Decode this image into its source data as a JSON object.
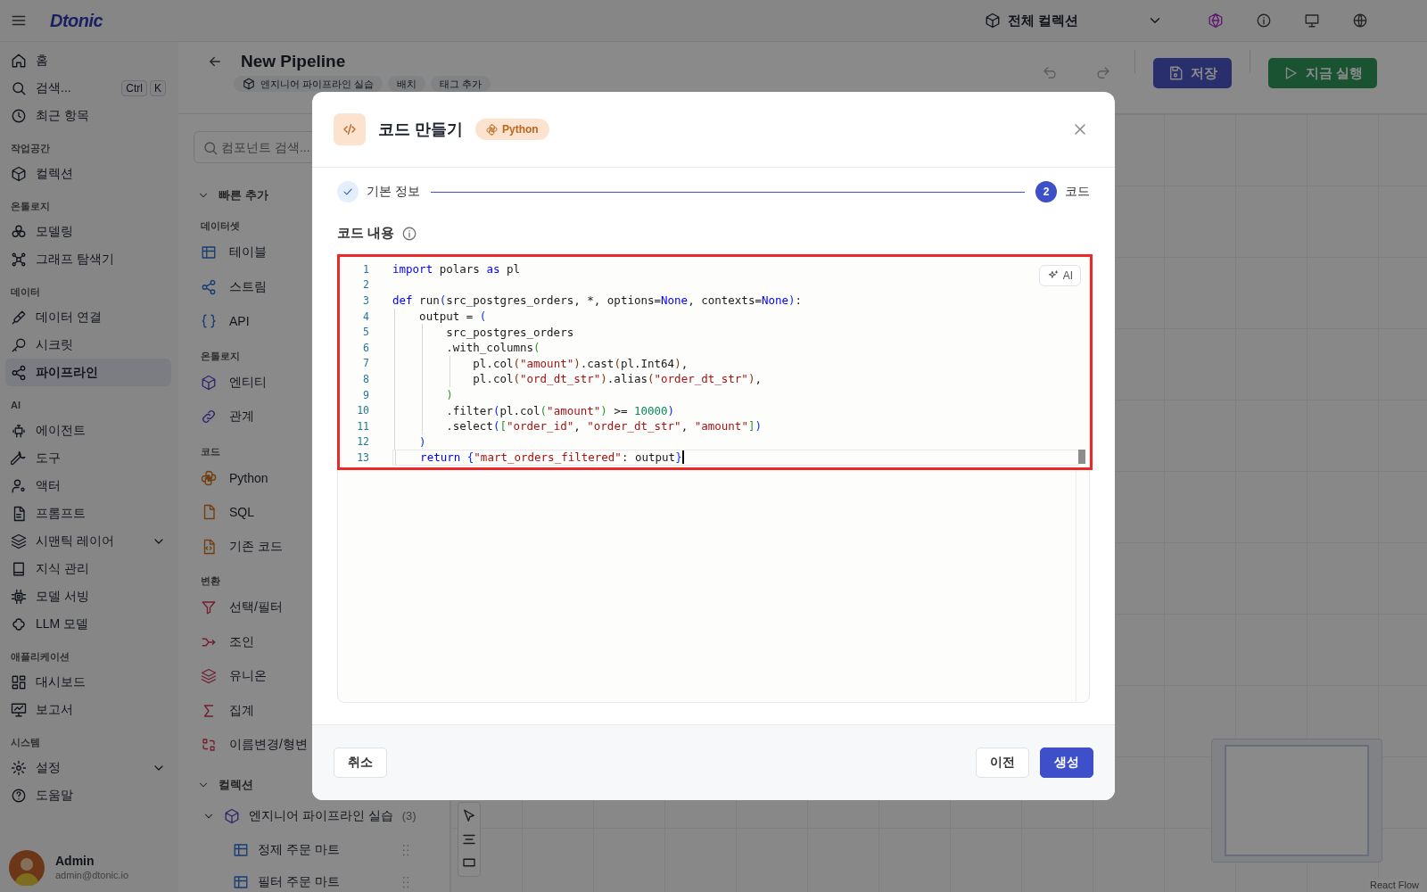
{
  "app": {
    "logo": "Dtonic"
  },
  "topbar": {
    "collection_select": "전체 컬렉션"
  },
  "sidebar": {
    "sections": [
      {
        "items": [
          {
            "label": "홈",
            "selected": false
          },
          {
            "label": "검색...",
            "selected": false,
            "shortcut": [
              "Ctrl",
              "K"
            ]
          },
          {
            "label": "최근 항목",
            "selected": false
          }
        ]
      },
      {
        "title": "작업공간",
        "items": [
          {
            "label": "컬렉션",
            "selected": false
          }
        ]
      },
      {
        "title": "온톨로지",
        "items": [
          {
            "label": "모델링",
            "selected": false
          },
          {
            "label": "그래프 탐색기",
            "selected": false
          }
        ]
      },
      {
        "title": "데이터",
        "items": [
          {
            "label": "데이터 연결",
            "selected": false
          },
          {
            "label": "시크릿",
            "selected": false
          },
          {
            "label": "파이프라인",
            "selected": true
          }
        ]
      },
      {
        "title": "AI",
        "items": [
          {
            "label": "에이전트",
            "selected": false
          },
          {
            "label": "도구",
            "selected": false
          },
          {
            "label": "액터",
            "selected": false
          },
          {
            "label": "프롬프트",
            "selected": false
          },
          {
            "label": "시맨틱 레이어",
            "selected": false,
            "expanded": false
          },
          {
            "label": "지식 관리",
            "selected": false
          },
          {
            "label": "모델 서빙",
            "selected": false
          },
          {
            "label": "LLM 모델",
            "selected": false
          }
        ]
      },
      {
        "title": "애플리케이션",
        "items": [
          {
            "label": "대시보드",
            "selected": false
          },
          {
            "label": "보고서",
            "selected": false
          }
        ]
      },
      {
        "title": "시스템",
        "items": [
          {
            "label": "설정",
            "selected": false,
            "expanded": false
          },
          {
            "label": "도움말",
            "selected": false
          }
        ]
      }
    ],
    "user": {
      "name": "Admin",
      "email": "admin@dtonic.io"
    }
  },
  "pipeline": {
    "title": "New Pipeline",
    "tags": [
      "엔지니어 파이프라인 실습",
      "배치",
      "태그 추가"
    ],
    "save": "저장",
    "run": "지금 실행"
  },
  "components": {
    "search_placeholder": "컴포넌트 검색...",
    "quick_add": {
      "title": "빠른 추가",
      "expanded": true,
      "groups": [
        {
          "title": "데이터셋",
          "items": [
            "테이블",
            "스트림",
            "API"
          ]
        },
        {
          "title": "온톨로지",
          "items": [
            "엔티티",
            "관계"
          ]
        },
        {
          "title": "코드",
          "items": [
            "Python",
            "SQL",
            "기존 코드"
          ]
        },
        {
          "title": "변환",
          "items": [
            "선택/필터",
            "조인",
            "유니온",
            "집계",
            "이름변경/형변"
          ]
        }
      ]
    },
    "collections": {
      "title": "컬렉션",
      "expanded": true,
      "items": [
        {
          "label": "엔지니어 파이프라인 실습",
          "count": "(3)",
          "expanded": true,
          "children": [
            {
              "label": "정제 주문 마트"
            },
            {
              "label": "필터 주문 마트"
            }
          ]
        }
      ]
    }
  },
  "canvas": {
    "attribution": "React Flow"
  },
  "dialog": {
    "title": "코드 만들기",
    "badge": "Python",
    "steps": [
      {
        "label": "기본 정보",
        "completed": true,
        "selected": false
      },
      {
        "label": "코드",
        "completed": false,
        "selected": true,
        "number": "2"
      }
    ],
    "section_label": "코드 내용",
    "ai_button": "AI",
    "lines": [
      {
        "number": "1",
        "active": false,
        "tokens": [
          {
            "text": "import",
            "kind": "keyword"
          },
          {
            "text": " polars ",
            "kind": "plain"
          },
          {
            "text": "as",
            "kind": "keyword"
          },
          {
            "text": " pl",
            "kind": "plain"
          }
        ]
      },
      {
        "number": "2",
        "active": false
      },
      {
        "number": "3",
        "active": false,
        "tokens": [
          {
            "text": "def",
            "kind": "keyword"
          },
          {
            "text": " run",
            "kind": "plain"
          },
          {
            "text": "(",
            "kind": "bracket1"
          },
          {
            "text": "src_postgres_orders, *, options=",
            "kind": "plain"
          },
          {
            "text": "None",
            "kind": "keyword"
          },
          {
            "text": ", contexts=",
            "kind": "plain"
          },
          {
            "text": "None",
            "kind": "keyword"
          },
          {
            "text": ")",
            "kind": "bracket1"
          },
          {
            "text": ":",
            "kind": "plain"
          }
        ]
      },
      {
        "number": "4",
        "active": false,
        "tokens": [
          {
            "text": "    output = ",
            "kind": "plain"
          },
          {
            "text": "(",
            "kind": "bracket1"
          }
        ]
      },
      {
        "number": "5",
        "active": false,
        "tokens": [
          {
            "text": "        src_postgres_orders",
            "kind": "plain"
          }
        ]
      },
      {
        "number": "6",
        "active": false,
        "tokens": [
          {
            "text": "        .with_columns",
            "kind": "plain"
          },
          {
            "text": "(",
            "kind": "bracket2"
          }
        ]
      },
      {
        "number": "7",
        "active": false,
        "tokens": [
          {
            "text": "            pl.col",
            "kind": "plain"
          },
          {
            "text": "(",
            "kind": "bracket3"
          },
          {
            "text": "\"amount\"",
            "kind": "string"
          },
          {
            "text": ")",
            "kind": "bracket3"
          },
          {
            "text": ".cast",
            "kind": "plain"
          },
          {
            "text": "(",
            "kind": "bracket3"
          },
          {
            "text": "pl.Int64",
            "kind": "plain"
          },
          {
            "text": ")",
            "kind": "bracket3"
          },
          {
            "text": ",",
            "kind": "plain"
          }
        ]
      },
      {
        "number": "8",
        "active": false,
        "tokens": [
          {
            "text": "            pl.col",
            "kind": "plain"
          },
          {
            "text": "(",
            "kind": "bracket3"
          },
          {
            "text": "\"ord_dt_str\"",
            "kind": "string"
          },
          {
            "text": ")",
            "kind": "bracket3"
          },
          {
            "text": ".alias",
            "kind": "plain"
          },
          {
            "text": "(",
            "kind": "bracket3"
          },
          {
            "text": "\"order_dt_str\"",
            "kind": "string"
          },
          {
            "text": ")",
            "kind": "bracket3"
          },
          {
            "text": ",",
            "kind": "plain"
          }
        ]
      },
      {
        "number": "9",
        "active": false,
        "tokens": [
          {
            "text": "        )",
            "kind": "bracket2"
          }
        ]
      },
      {
        "number": "10",
        "active": false,
        "tokens": [
          {
            "text": "        .filter",
            "kind": "plain"
          },
          {
            "text": "(",
            "kind": "bracket1"
          },
          {
            "text": "pl.col",
            "kind": "plain"
          },
          {
            "text": "(",
            "kind": "bracket2"
          },
          {
            "text": "\"amount\"",
            "kind": "string"
          },
          {
            "text": ")",
            "kind": "bracket2"
          },
          {
            "text": " >= ",
            "kind": "plain"
          },
          {
            "text": "10000",
            "kind": "number"
          },
          {
            "text": ")",
            "kind": "bracket1"
          }
        ]
      },
      {
        "number": "11",
        "active": false,
        "tokens": [
          {
            "text": "        .select",
            "kind": "plain"
          },
          {
            "text": "(",
            "kind": "bracket1"
          },
          {
            "text": "[",
            "kind": "bracket2"
          },
          {
            "text": "\"order_id\"",
            "kind": "string"
          },
          {
            "text": ", ",
            "kind": "plain"
          },
          {
            "text": "\"order_dt_str\"",
            "kind": "string"
          },
          {
            "text": ", ",
            "kind": "plain"
          },
          {
            "text": "\"amount\"",
            "kind": "string"
          },
          {
            "text": "]",
            "kind": "bracket2"
          },
          {
            "text": ")",
            "kind": "bracket1"
          }
        ]
      },
      {
        "number": "12",
        "active": false,
        "tokens": [
          {
            "text": "    )",
            "kind": "bracket1"
          }
        ]
      },
      {
        "number": "13",
        "active": true,
        "tokens": [
          {
            "text": "    return ",
            "kind": "keyword"
          },
          {
            "text": "{",
            "kind": "bracket1"
          },
          {
            "text": "\"mart_orders_filtered\"",
            "kind": "string"
          },
          {
            "text": ": output",
            "kind": "plain"
          },
          {
            "text": "}",
            "kind": "bracket1"
          }
        ]
      }
    ],
    "cancel": "취소",
    "previous": "이전",
    "create": "생성"
  }
}
